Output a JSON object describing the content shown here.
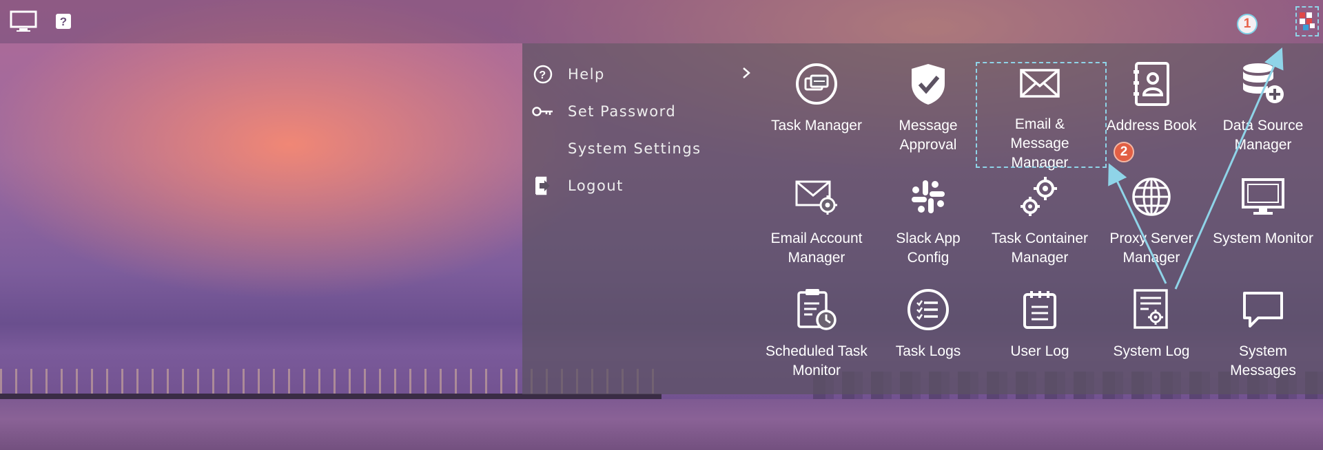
{
  "side_menu": {
    "items": [
      {
        "label": "Help",
        "icon": "help-circle-icon",
        "has_submenu": true
      },
      {
        "label": "Set Password",
        "icon": "key-icon"
      },
      {
        "label": "System Settings",
        "icon": ""
      },
      {
        "label": "Logout",
        "icon": "logout-icon"
      }
    ]
  },
  "apps": [
    {
      "label": "Task Manager",
      "icon": "task-manager-icon"
    },
    {
      "label": "Message\nApproval",
      "icon": "shield-check-icon"
    },
    {
      "label": "Email & Message\nManager",
      "icon": "envelope-icon"
    },
    {
      "label": "Address Book",
      "icon": "address-book-icon"
    },
    {
      "label": "Data Source\nManager",
      "icon": "database-add-icon"
    },
    {
      "label": "Email Account\nManager",
      "icon": "email-gear-icon"
    },
    {
      "label": "Slack App\nConfig",
      "icon": "slack-icon"
    },
    {
      "label": "Task Container\nManager",
      "icon": "gears-icon"
    },
    {
      "label": "Proxy Server\nManager",
      "icon": "globe-icon"
    },
    {
      "label": "System Monitor",
      "icon": "monitor-icon"
    },
    {
      "label": "Scheduled Task\nMonitor",
      "icon": "clipboard-clock-icon"
    },
    {
      "label": "Task Logs",
      "icon": "list-circle-icon"
    },
    {
      "label": "User Log",
      "icon": "notepad-icon"
    },
    {
      "label": "System Log",
      "icon": "document-gear-icon"
    },
    {
      "label": "System\nMessages",
      "icon": "speech-bubble-icon"
    }
  ],
  "annotations": {
    "step1": "1",
    "step2": "2",
    "accent_color": "#8fd4e8",
    "badge_color": "#e25f44"
  }
}
